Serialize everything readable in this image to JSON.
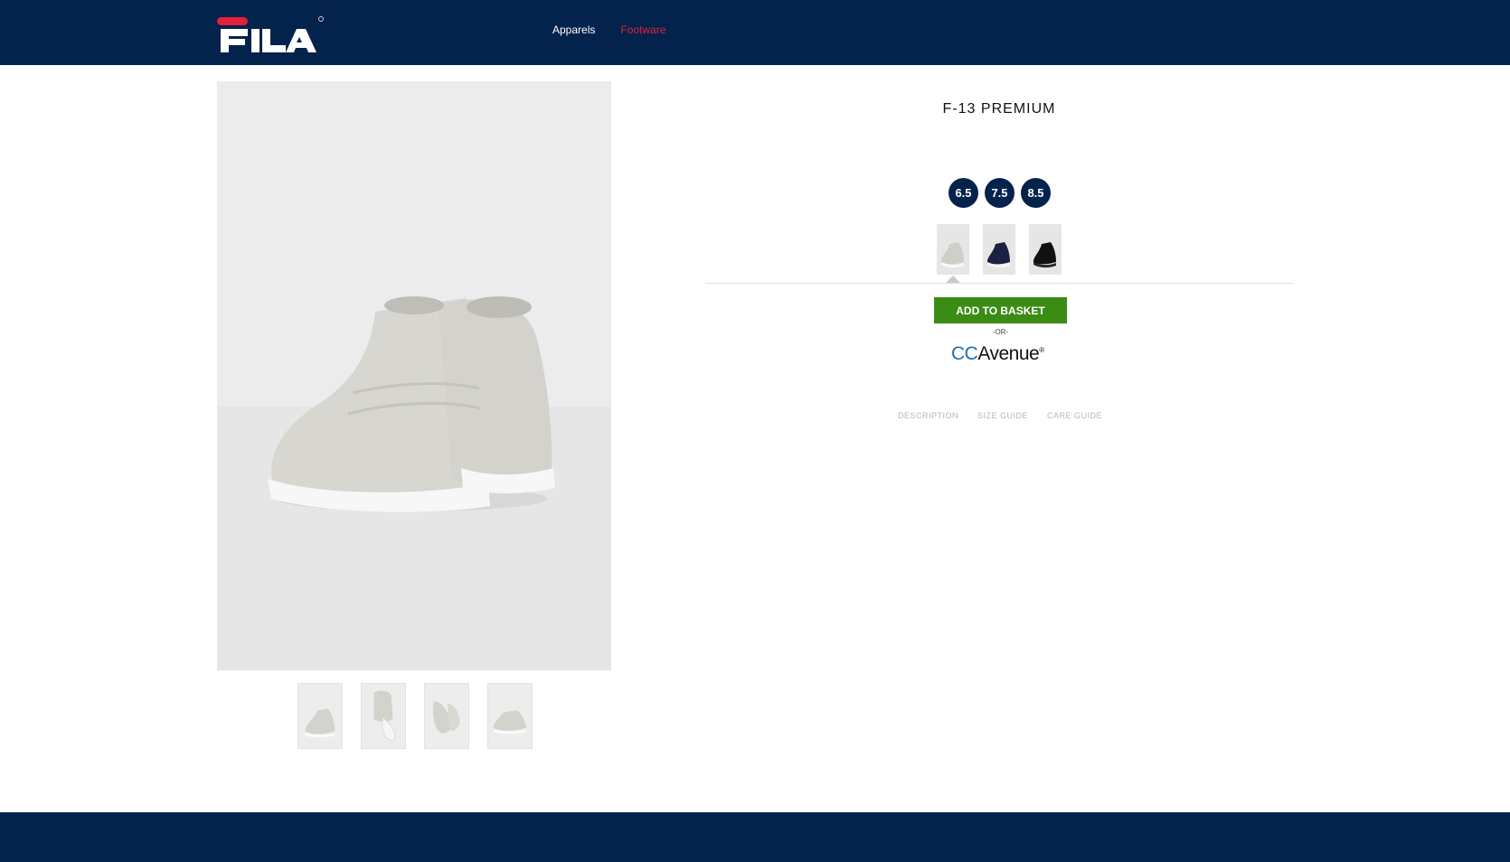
{
  "header": {
    "logo_text": "FILA",
    "nav": [
      {
        "label": "Apparels",
        "active": false
      },
      {
        "label": "Footware",
        "active": true
      }
    ],
    "colors": {
      "background": "#03224c",
      "active_link": "#e2203d",
      "logo_red": "#e2203d"
    }
  },
  "product": {
    "title": "F-13  PREMIUM",
    "sizes": [
      "6.5",
      "7.5",
      "8.5"
    ],
    "color_options": [
      {
        "name": "grey-shoe-icon",
        "selected": true
      },
      {
        "name": "navy-shoe-icon",
        "selected": false
      },
      {
        "name": "black-shoe-icon",
        "selected": false
      }
    ],
    "add_to_basket_label": "ADD TO BASKET",
    "or_label": "-OR-",
    "payment": {
      "cc": "CC",
      "rest": "Avenue",
      "reg": "®"
    },
    "tabs": [
      "DESCRIPTION",
      "SIZE  GUIDE",
      "CARE  GUIDE"
    ]
  },
  "gallery": {
    "thumbnail_count": 4
  },
  "colors": {
    "primary": "#03224c",
    "button": "#3a8c14"
  }
}
